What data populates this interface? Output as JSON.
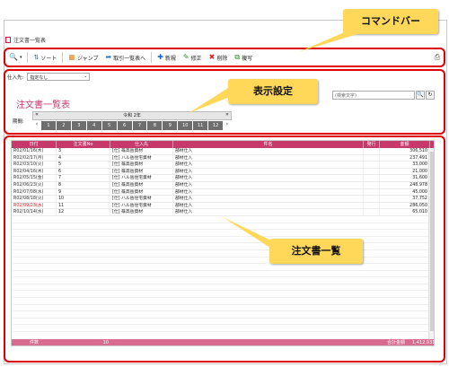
{
  "tab": {
    "title": "注文書一覧表"
  },
  "toolbar": {
    "search_icon": "search-icon",
    "sort_label": "ソート",
    "jump_label": "ジャンプ",
    "supplier_list_label": "取引一覧表へ",
    "new_label": "新規",
    "edit_label": "修正",
    "delete_label": "削除",
    "copy_label": "複写"
  },
  "filter": {
    "label": "仕入先:",
    "value": "指定なし"
  },
  "page": {
    "title": "注文書一覧表"
  },
  "search": {
    "placeholder": "(検索文字)"
  },
  "period": {
    "label": "期間:",
    "year_label": "令和 2年",
    "months": [
      "1",
      "2",
      "3",
      "4",
      "5",
      "6",
      "7",
      "8",
      "9",
      "10",
      "11",
      "12"
    ]
  },
  "table": {
    "columns": [
      "日付",
      "注文書No",
      "仕入先",
      "件名",
      "発行",
      "金額"
    ],
    "rows": [
      {
        "date": "R02/01/16(木)",
        "no": "3",
        "supplier": "[仕] 篠高岳資材",
        "subject": "部材仕入",
        "issued": "",
        "amount": "306,510",
        "red": false
      },
      {
        "date": "R02/02/17(月)",
        "no": "4",
        "supplier": "[仕] ハル岳住宅資材",
        "subject": "部材仕入",
        "issued": "",
        "amount": "237,491",
        "red": false
      },
      {
        "date": "R02/03/10(火)",
        "no": "5",
        "supplier": "[仕] 篠高岳資材",
        "subject": "部材仕入",
        "issued": "",
        "amount": "33,000",
        "red": false
      },
      {
        "date": "R02/04/16(木)",
        "no": "6",
        "supplier": "[仕] 篠高岳資材",
        "subject": "部材仕入",
        "issued": "",
        "amount": "21,000",
        "red": false
      },
      {
        "date": "R02/05/15(金)",
        "no": "7",
        "supplier": "[仕] ハル岳住宅資材",
        "subject": "部材仕入",
        "issued": "",
        "amount": "31,600",
        "red": false
      },
      {
        "date": "R02/06/23(火)",
        "no": "8",
        "supplier": "[仕] 篠高岳資材",
        "subject": "部材仕入",
        "issued": "",
        "amount": "248,978",
        "red": false
      },
      {
        "date": "R02/07/08(水)",
        "no": "9",
        "supplier": "[仕] 篠高岳資材",
        "subject": "部材仕入",
        "issued": "",
        "amount": "45,000",
        "red": false
      },
      {
        "date": "R02/08/18(火)",
        "no": "10",
        "supplier": "[仕] ハル岳住宅資材",
        "subject": "部材仕入",
        "issued": "",
        "amount": "37,752",
        "red": false
      },
      {
        "date": "R02/09/23(水)",
        "no": "11",
        "supplier": "[仕] ハル岳住宅資材",
        "subject": "部材仕入",
        "issued": "",
        "amount": "286,050",
        "red": true
      },
      {
        "date": "R02/10/14(水)",
        "no": "12",
        "supplier": "[仕] 篠高岳資材",
        "subject": "部材仕入",
        "issued": "",
        "amount": "65,010",
        "red": false
      }
    ],
    "footer": {
      "count_label": "件数",
      "count": "10",
      "total_label": "合計金額",
      "total": "1,412,931"
    }
  },
  "callouts": {
    "command_bar": "コマンドバー",
    "display_settings": "表示設定",
    "order_list": "注文書一覧"
  },
  "colors": {
    "accent": "#c8396b",
    "callout": "#ffd85a",
    "highlight_border": "#e00000"
  }
}
